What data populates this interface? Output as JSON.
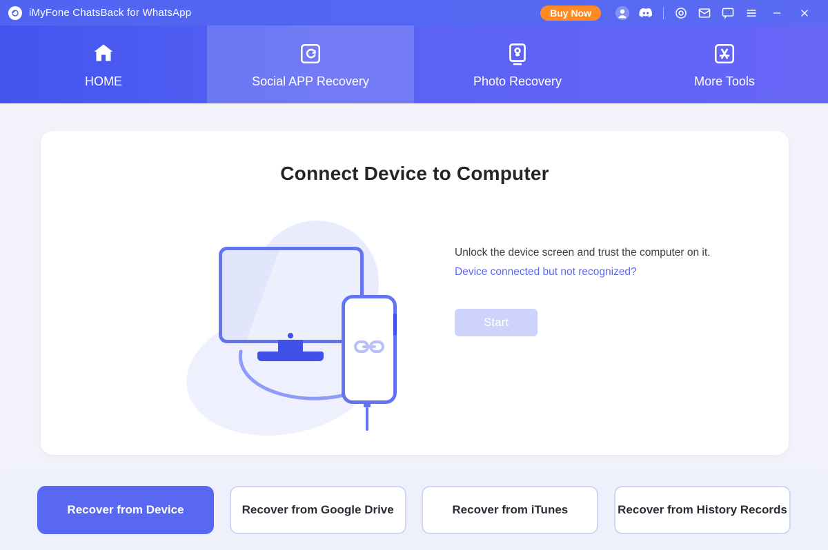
{
  "titlebar": {
    "app_title": "iMyFone ChatsBack for WhatsApp",
    "buy_now": "Buy Now"
  },
  "nav": {
    "items": [
      {
        "label": "HOME"
      },
      {
        "label": "Social APP Recovery"
      },
      {
        "label": "Photo Recovery"
      },
      {
        "label": "More Tools"
      }
    ],
    "active_index": 1
  },
  "main": {
    "heading": "Connect Device to Computer",
    "instruction": "Unlock the device screen and trust the computer on it.",
    "troubleshoot_link": "Device connected but not recognized?",
    "start_label": "Start",
    "start_enabled": false
  },
  "options": [
    {
      "label": "Recover from Device",
      "selected": true
    },
    {
      "label": "Recover from Google Drive",
      "selected": false
    },
    {
      "label": "Recover from iTunes",
      "selected": false
    },
    {
      "label": "Recover from History Records",
      "selected": false
    }
  ]
}
